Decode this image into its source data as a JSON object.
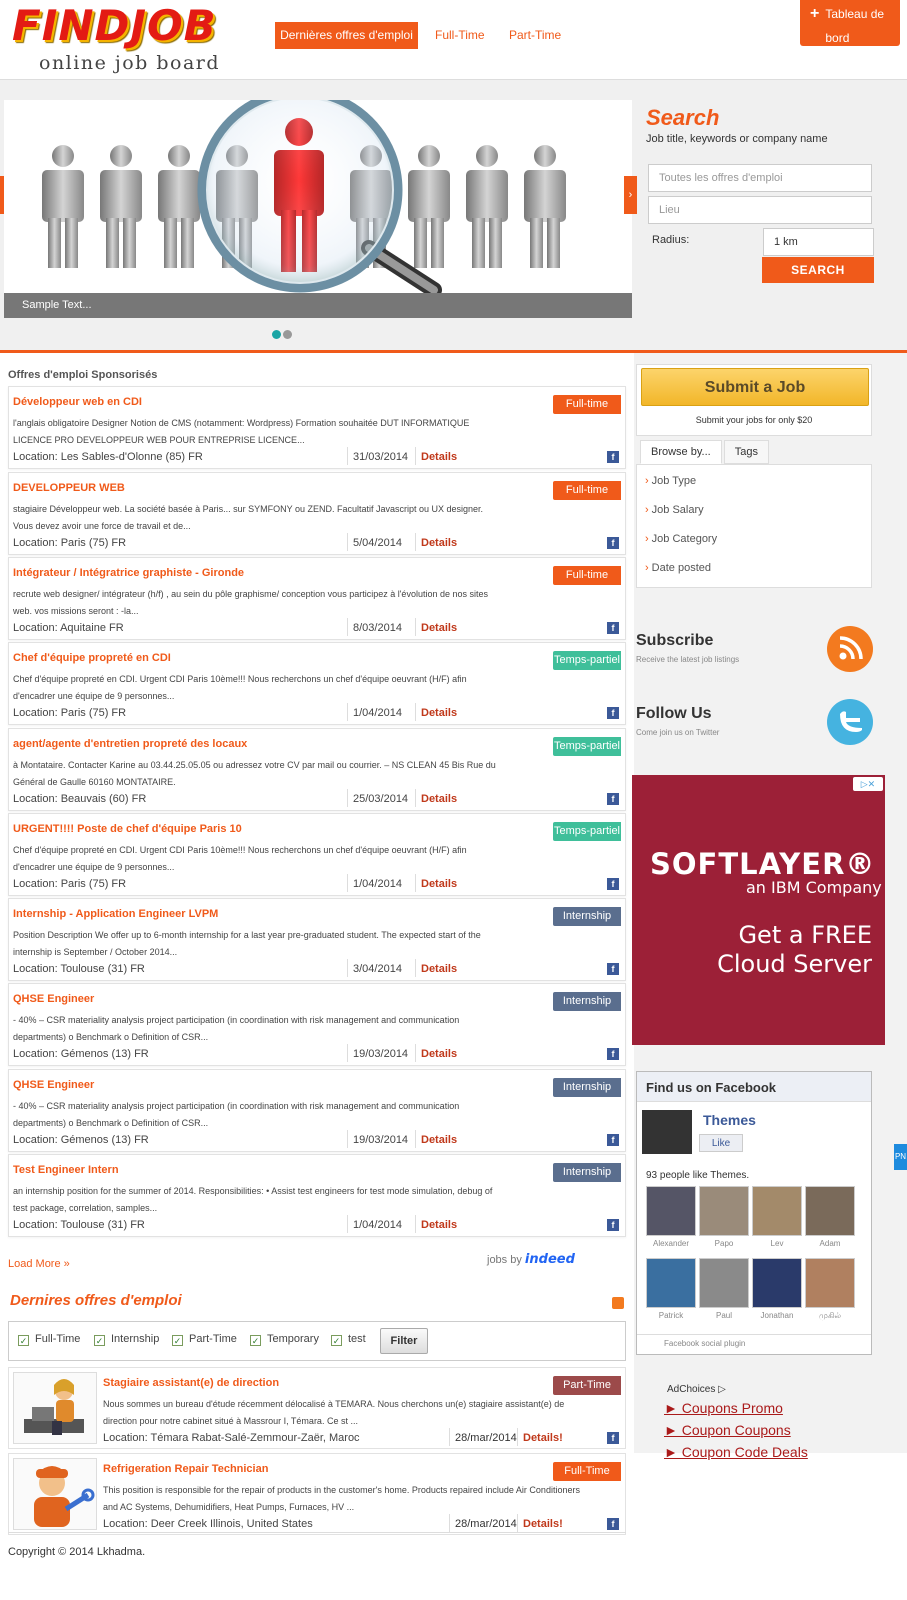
{
  "brand": {
    "name": "FINDJOB",
    "tagline": "online job board"
  },
  "nav": {
    "latest": "Dernières offres d'emploi",
    "fulltime": "Full-Time",
    "parttime": "Part-Time"
  },
  "dashboard": {
    "label": "Tableau de bord"
  },
  "slider": {
    "caption": "Sample Text...",
    "prev": "‹",
    "next": "›"
  },
  "search": {
    "title": "Search",
    "subtitle": "Job title, keywords or company name",
    "keywords_placeholder": "Toutes les offres d'emploi",
    "location_placeholder": "Lieu",
    "radius_label": "Radius:",
    "radius_value": "1 km",
    "button": "SEARCH"
  },
  "sponsored": {
    "heading": "Offres d'emploi Sponsorisés",
    "details_label": "Details",
    "fb": "f",
    "jobs": [
      {
        "title": "Développeur web en CDI",
        "type": "Full-time",
        "badge_color": "#f05a1a",
        "desc": "l'anglais obligatoire Designer Notion de CMS (notamment: Wordpress) Formation souhaitée DUT INFORMATIQUE LICENCE PRO DEVELOPPEUR WEB POUR ENTREPRISE LICENCE...",
        "location": "Location: Les Sables-d'Olonne (85) FR",
        "date": "31/03/2014"
      },
      {
        "title": "DEVELOPPEUR WEB",
        "type": "Full-time",
        "badge_color": "#f05a1a",
        "desc": "stagiaire Développeur web. La société basée à Paris... sur SYMFONY ou ZEND. Facultatif Javascript ou UX designer. Vous devez avoir une force de travail et de...",
        "location": "Location: Paris (75) FR",
        "date": "5/04/2014"
      },
      {
        "title": "Intégrateur / Intégratrice graphiste - Gironde",
        "type": "Full-time",
        "badge_color": "#f05a1a",
        "desc": "recrute web designer/ intégrateur (h/f) , au sein du pôle graphisme/ conception vous participez à l'évolution de nos sites web. vos missions seront : -la...",
        "location": "Location: Aquitaine FR",
        "date": "8/03/2014"
      },
      {
        "title": "Chef d'équipe propreté en CDI",
        "type": "Temps-partiel",
        "badge_color": "#3fbf9a",
        "desc": "Chef d'équipe propreté en CDI. Urgent CDI Paris 10ème!!! Nous recherchons un chef d'équipe oeuvrant (H/F) afin d'encadrer une équipe de 9 personnes...",
        "location": "Location: Paris (75) FR",
        "date": "1/04/2014"
      },
      {
        "title": "agent/agente d'entretien propreté des locaux",
        "type": "Temps-partiel",
        "badge_color": "#3fbf9a",
        "desc": "à Montataire. Contacter Karine au 03.44.25.05.05 ou adressez votre CV par mail ou courrier. – NS CLEAN 45 Bis Rue du Général de Gaulle 60160 MONTATAIRE.",
        "location": "Location: Beauvais (60) FR",
        "date": "25/03/2014"
      },
      {
        "title": "URGENT!!!! Poste de chef d'équipe Paris 10",
        "type": "Temps-partiel",
        "badge_color": "#3fbf9a",
        "desc": "Chef d'équipe propreté en CDI. Urgent CDI Paris 10ème!!! Nous recherchons un chef d'équipe oeuvrant (H/F) afin d'encadrer une équipe de 9 personnes...",
        "location": "Location: Paris (75) FR",
        "date": "1/04/2014"
      },
      {
        "title": "Internship - Application Engineer LVPM",
        "type": "Internship",
        "badge_color": "#5a6e8e",
        "desc": "Position Description We offer up to 6-month internship for a last year pre-graduated student. The expected start of the internship is September / October 2014...",
        "location": "Location: Toulouse (31) FR",
        "date": "3/04/2014"
      },
      {
        "title": "QHSE Engineer",
        "type": "Internship",
        "badge_color": "#5a6e8e",
        "desc": "- 40% – CSR materiality analysis project participation (in coordination with risk management and communication departments) o Benchmark o Definition of CSR...",
        "location": "Location: Gémenos (13) FR",
        "date": "19/03/2014"
      },
      {
        "title": "QHSE Engineer",
        "type": "Internship",
        "badge_color": "#5a6e8e",
        "desc": "- 40% – CSR materiality analysis project participation (in coordination with risk management and communication departments) o Benchmark o Definition of CSR...",
        "location": "Location: Gémenos (13) FR",
        "date": "19/03/2014"
      },
      {
        "title": "Test Engineer Intern",
        "type": "Internship",
        "badge_color": "#5a6e8e",
        "desc": "an internship position for the summer of 2014. Responsibilities: • Assist test engineers for test mode simulation, debug of test package, correlation, samples...",
        "location": "Location: Toulouse (31) FR",
        "date": "1/04/2014"
      }
    ]
  },
  "load_more": "Load More »",
  "jobs_by": {
    "prefix": "jobs by",
    "brand": "indeed"
  },
  "latest": {
    "heading": "Dernires offres d'emploi",
    "details_label": "Details!",
    "fb": "f",
    "filters": [
      {
        "label": "Full-Time",
        "check": "✓"
      },
      {
        "label": "Internship",
        "check": "✓"
      },
      {
        "label": "Part-Time",
        "check": "✓"
      },
      {
        "label": "Temporary",
        "check": "✓"
      },
      {
        "label": "test",
        "check": "✓"
      }
    ],
    "filter_button": "Filter",
    "jobs": [
      {
        "title": "Stagiaire assistant(e) de direction",
        "type": "Part-Time",
        "badge_color": "#9c4a4a",
        "desc": "Nous sommes un bureau d'étude récemment délocalisé à TEMARA. Nous cherchons un(e) stagiaire assistant(e) de direction pour notre cabinet situé à Massrour I, Témara. Ce st ...",
        "location": "Location: Témara Rabat-Salé-Zemmour-Zaër, Maroc",
        "date": "28/mar/2014"
      },
      {
        "title": "Refrigeration Repair Technician",
        "type": "Full-Time",
        "badge_color": "#f05a1a",
        "desc": "This position is responsible for the repair of products in the customer's home. Products repaired include Air Conditioners and AC Systems, Dehumidifiers, Heat Pumps, Furnaces, HV ...",
        "location": "Location: Deer Creek Illinois, United States",
        "date": "28/mar/2014"
      }
    ]
  },
  "copyright": "Copyright © 2014 Lkhadma.",
  "sidebar": {
    "submit_button": "Submit a Job",
    "submit_note": "Submit your jobs for only $20",
    "tabs": [
      "Browse by...",
      "Tags"
    ],
    "browse_items": [
      "Job Type",
      "Job Salary",
      "Job Category",
      "Date posted"
    ],
    "subscribe": {
      "title": "Subscribe",
      "text": "Receive the latest job listings"
    },
    "follow": {
      "title": "Follow Us",
      "text": "Come join us on Twitter"
    },
    "ad": {
      "brand": "SOFTLAYER®",
      "sub": "an IBM Company",
      "line1": "Get a FREE",
      "line2": "Cloud Server",
      "badge": "▷✕"
    },
    "facebook": {
      "heading": "Find us on Facebook",
      "page": "Themes",
      "like": "Like",
      "count": "93 people like Themes.",
      "plugin": "Facebook social plugin",
      "fans": [
        "Alexander",
        "Papo",
        "Lev",
        "Adam",
        "Patrick",
        "Paul",
        "Jonathan",
        "முகில்"
      ]
    },
    "adchoices": "AdChoices ▷",
    "ad_links": [
      "► Coupons Promo",
      "► Coupon Coupons",
      "► Coupon Code Deals"
    ],
    "pn": "PN"
  }
}
